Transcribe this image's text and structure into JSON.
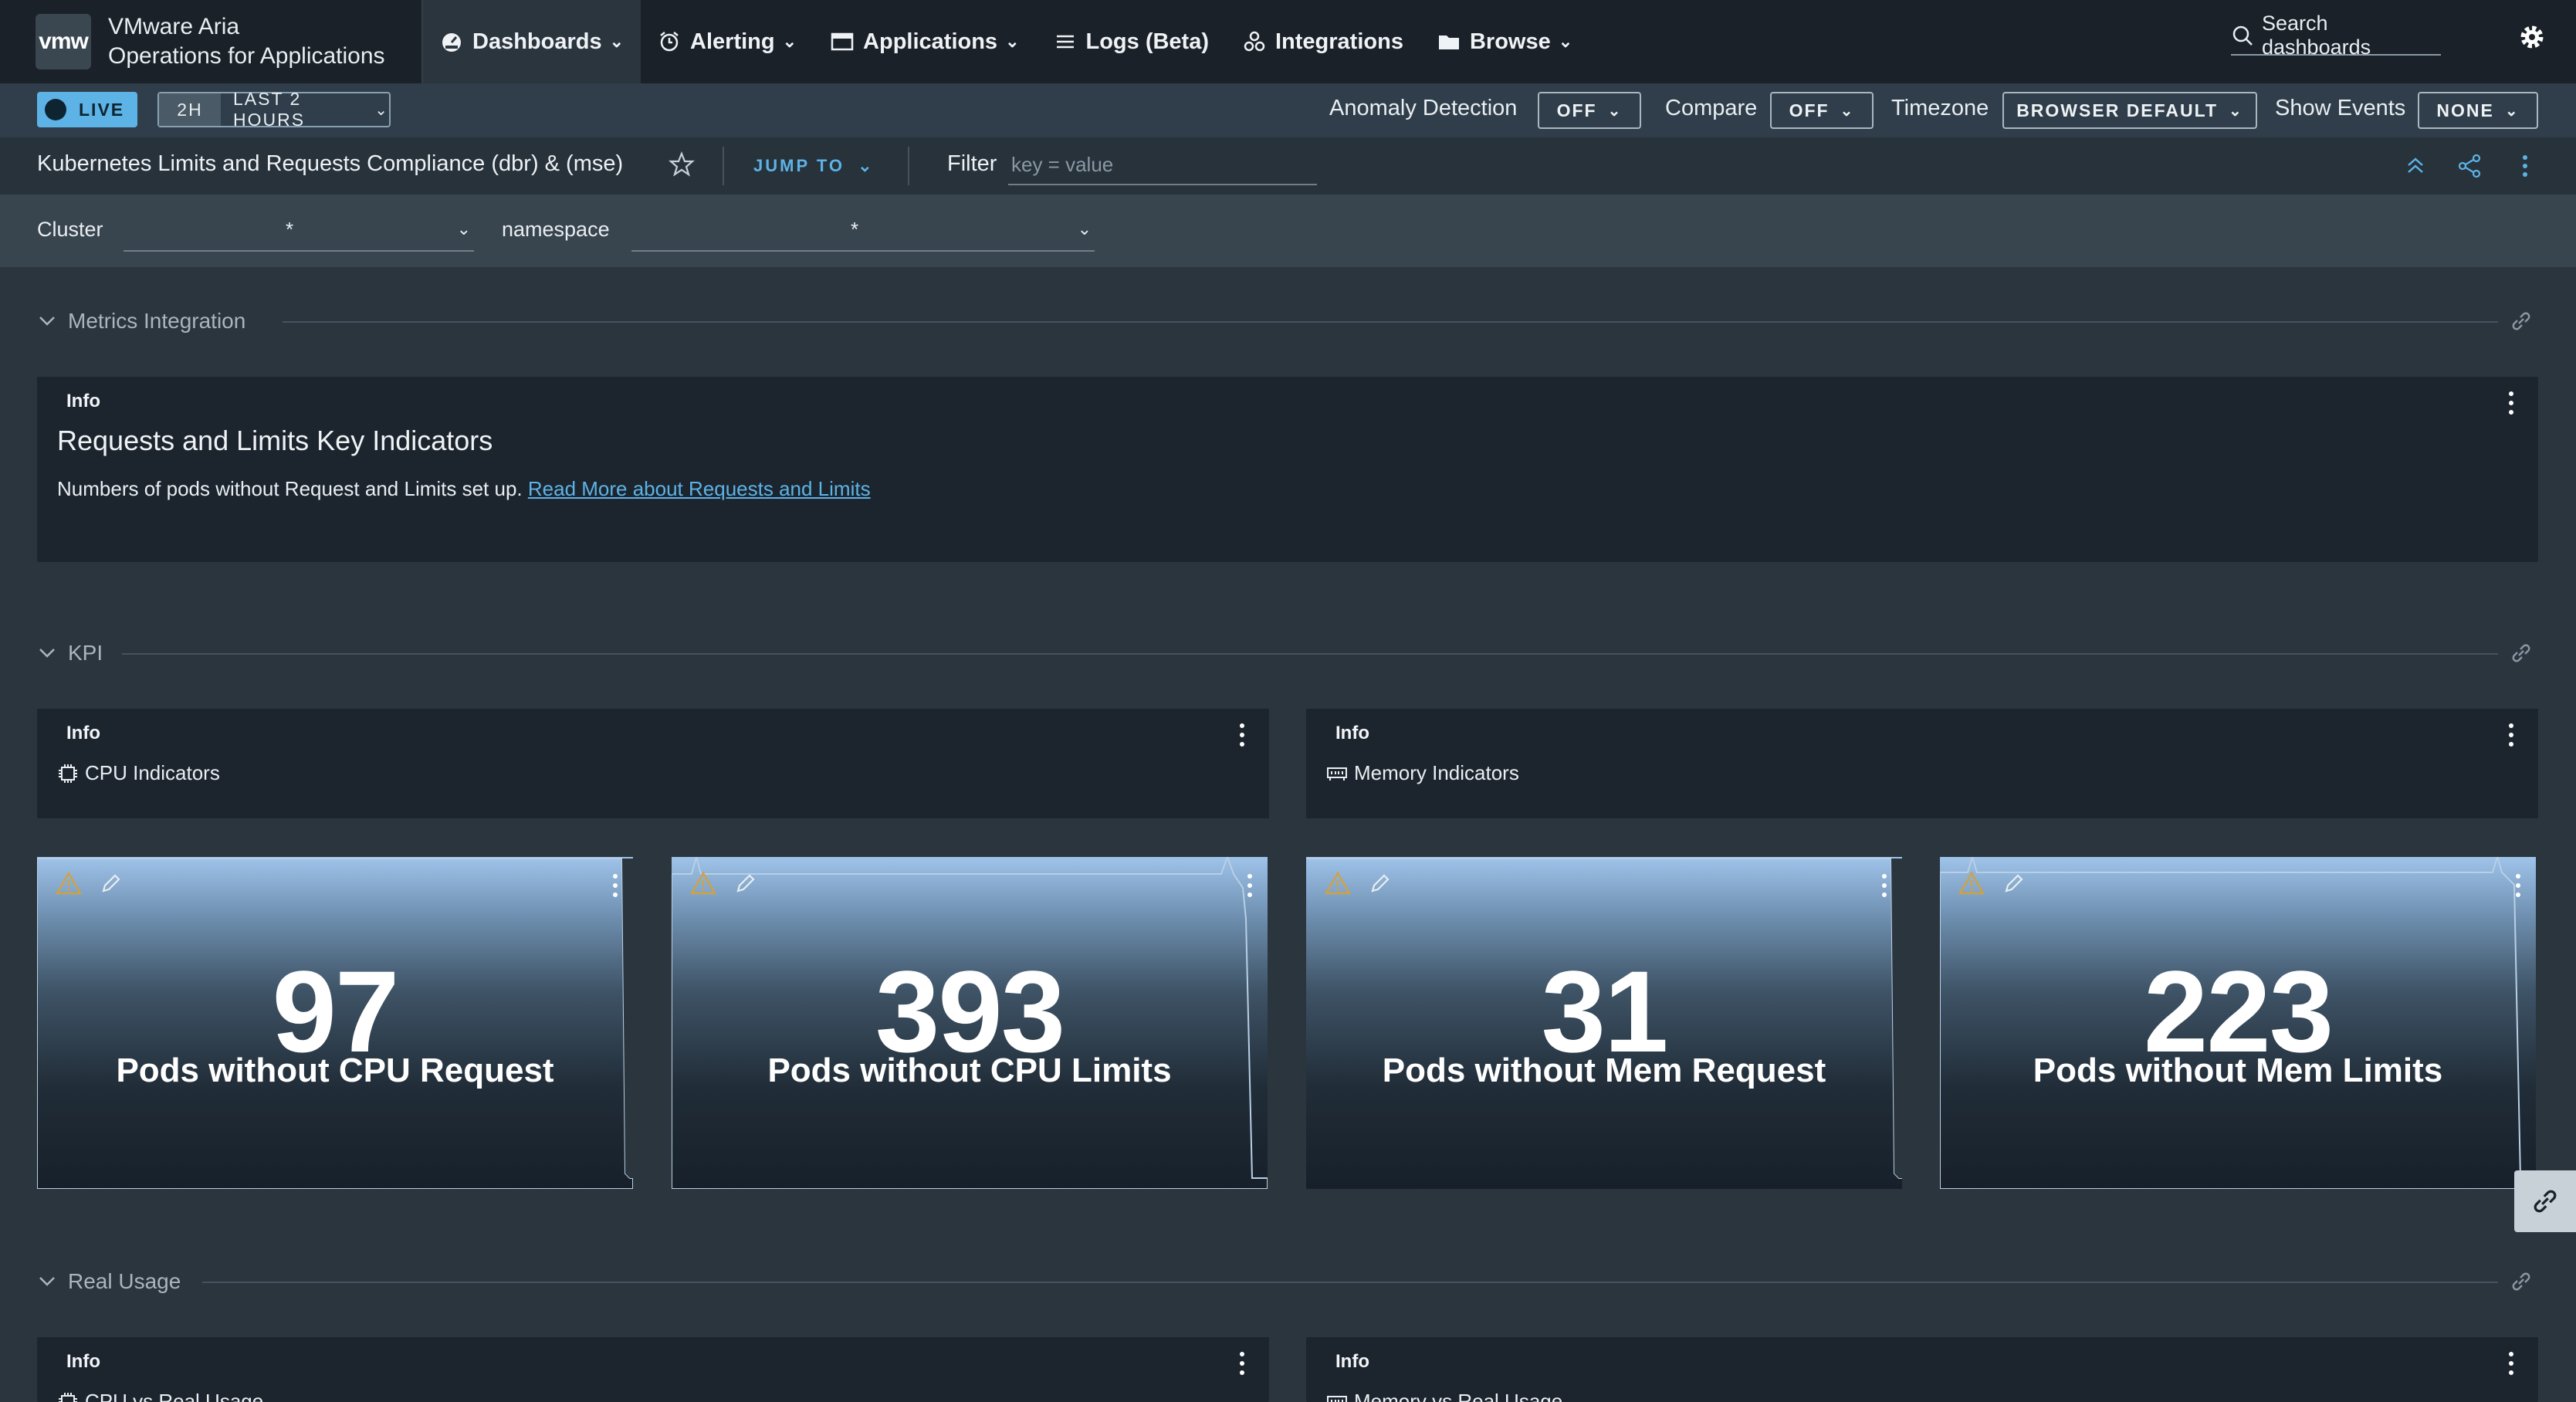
{
  "app": {
    "logo": "vmw",
    "name_line1": "VMware Aria",
    "name_line2": "Operations for Applications"
  },
  "nav": [
    {
      "label": "Dashboards",
      "icon": "dashboard-icon",
      "dropdown": true,
      "active": true
    },
    {
      "label": "Alerting",
      "icon": "alarm-icon",
      "dropdown": true
    },
    {
      "label": "Applications",
      "icon": "window-icon",
      "dropdown": true
    },
    {
      "label": "Logs (Beta)",
      "icon": "list-icon",
      "dropdown": false
    },
    {
      "label": "Integrations",
      "icon": "integrations-icon",
      "dropdown": false
    },
    {
      "label": "Browse",
      "icon": "folder-icon",
      "dropdown": true
    }
  ],
  "search": {
    "placeholder": "Search dashboards"
  },
  "timebar": {
    "live": "LIVE",
    "range_short": "2H",
    "range_label": "LAST 2 HOURS",
    "anomaly_label": "Anomaly Detection",
    "anomaly_value": "OFF",
    "compare_label": "Compare",
    "compare_value": "OFF",
    "timezone_label": "Timezone",
    "timezone_value": "BROWSER DEFAULT",
    "events_label": "Show Events",
    "events_value": "NONE"
  },
  "dashboard": {
    "title": "Kubernetes Limits and Requests Compliance (dbr) & (mse)",
    "jump_to": "JUMP TO",
    "filter_label": "Filter",
    "filter_placeholder": "key = value"
  },
  "variables": [
    {
      "label": "Cluster",
      "value": "*"
    },
    {
      "label": "namespace",
      "value": "*"
    }
  ],
  "sections": [
    {
      "title": "Metrics Integration"
    },
    {
      "title": "KPI"
    },
    {
      "title": "Real Usage"
    }
  ],
  "info_panel": {
    "type": "Info",
    "heading": "Requests and Limits Key Indicators",
    "text": "Numbers of pods without Request and Limits set up. ",
    "link": "Read More about Requests and Limits"
  },
  "kpi_info": [
    {
      "type": "Info",
      "label": "CPU Indicators",
      "icon": "cpu-icon"
    },
    {
      "type": "Info",
      "label": "Memory Indicators",
      "icon": "memory-icon"
    }
  ],
  "kpis": [
    {
      "value": "97",
      "label": "Pods without CPU Request"
    },
    {
      "value": "393",
      "label": "Pods without CPU Limits"
    },
    {
      "value": "31",
      "label": "Pods without Mem Request"
    },
    {
      "value": "223",
      "label": "Pods without Mem Limits"
    }
  ],
  "real_usage_info": [
    {
      "type": "Info",
      "label": "CPU vs Real Usage",
      "icon": "cpu-icon"
    },
    {
      "type": "Info",
      "label": "Memory vs Real Usage",
      "icon": "memory-icon"
    }
  ],
  "colors": {
    "accent": "#5db3e6",
    "nav_bg": "#1a2128",
    "page_bg": "#2a353e",
    "panel_bg": "#1c252d"
  }
}
